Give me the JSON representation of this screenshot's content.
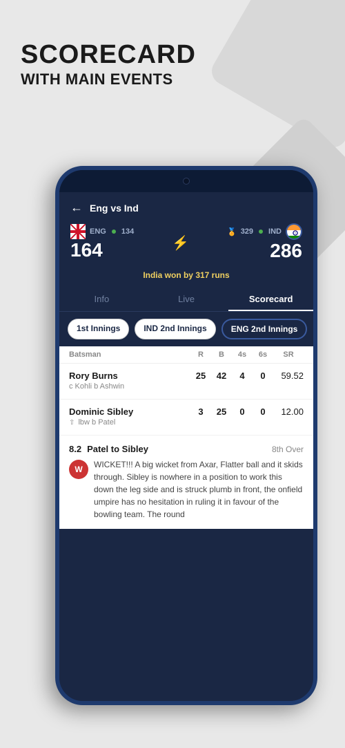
{
  "header": {
    "title": "SCORECARD",
    "subtitle": "WITH MAIN EVENTS"
  },
  "phone": {
    "top_bar": {
      "back_icon": "←",
      "match_title": "Eng vs Ind"
    },
    "score_section": {
      "team1": {
        "name": "ENG",
        "score_sub": "134",
        "score_main": "164"
      },
      "team2": {
        "name": "IND",
        "score_sub": "329",
        "score_main": "286"
      },
      "vs_icon": "⚡",
      "result": "India won by 317 runs"
    },
    "tabs": [
      {
        "label": "Info",
        "active": false
      },
      {
        "label": "Live",
        "active": false
      },
      {
        "label": "Scorecard",
        "active": true
      }
    ],
    "innings_tabs": [
      {
        "label": "1st Innings",
        "active": false
      },
      {
        "label": "IND 2nd Innings",
        "active": false
      },
      {
        "label": "ENG 2nd Innings",
        "active": true
      }
    ],
    "table_headers": {
      "batsman": "Batsman",
      "r": "R",
      "b": "B",
      "fours": "4s",
      "sixes": "6s",
      "sr": "SR"
    },
    "batsmen": [
      {
        "name": "Rory Burns",
        "r": "25",
        "b": "42",
        "fours": "4",
        "sixes": "0",
        "sr": "59.52",
        "dismissal": "c Kohli b Ashwin"
      },
      {
        "name": "Dominic Sibley",
        "r": "3",
        "b": "25",
        "fours": "0",
        "sixes": "0",
        "sr": "12.00",
        "dismissal": "lbw b Patel"
      }
    ],
    "event": {
      "ball": "8.2",
      "description": "Patel to Sibley",
      "over_label": "8th Over",
      "badge": "W",
      "text": "WICKET!!! A big wicket from Axar, Flatter ball and it skids through. Sibley is nowhere in a position to work this down the leg side and is struck plumb in front, the onfield umpire has no hesitation in ruling it in favour of the bowling team. The round"
    }
  }
}
